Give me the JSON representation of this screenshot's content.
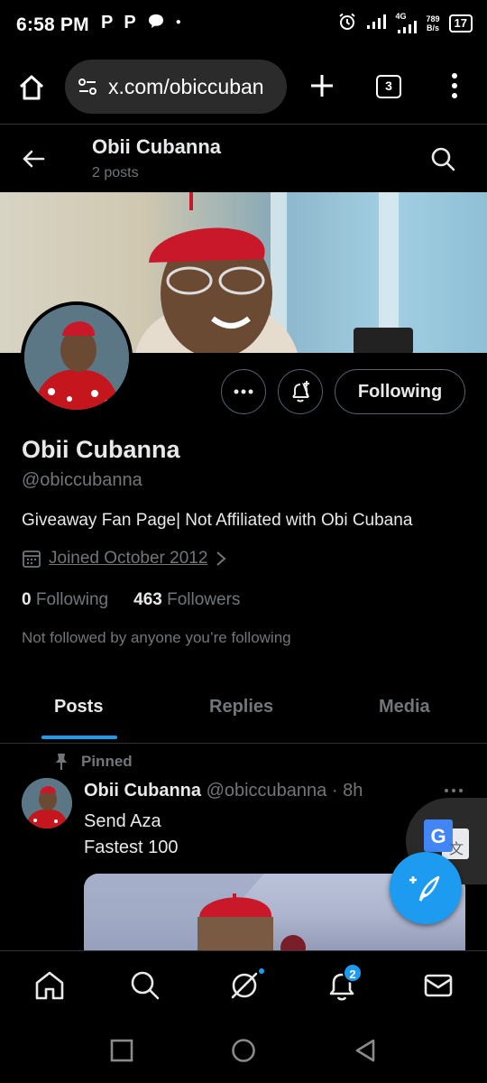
{
  "status_bar": {
    "time": "6:58 PM",
    "app_icons": [
      "P",
      "P"
    ],
    "network": "4G",
    "net_speed_value": "789",
    "net_speed_unit": "B/s",
    "battery": "17"
  },
  "browser": {
    "url": "x.com/obiccuban",
    "tab_count": "3"
  },
  "header": {
    "name": "Obii Cubanna",
    "post_count": "2 posts"
  },
  "profile": {
    "name": "Obii Cubanna",
    "handle": "@obiccubanna",
    "bio": "Giveaway Fan Page| Not Affiliated with Obi Cubana",
    "joined": "Joined October 2012",
    "following_count": "0",
    "following_label": "Following",
    "followers_count": "463",
    "followers_label": "Followers",
    "not_followed_text": "Not followed by anyone you’re following",
    "follow_button_label": "Following"
  },
  "tabs": [
    {
      "label": "Posts",
      "active": true
    },
    {
      "label": "Replies",
      "active": false
    },
    {
      "label": "Media",
      "active": false
    }
  ],
  "tweet": {
    "pinned_label": "Pinned",
    "author_name": "Obii Cubanna",
    "author_handle": "@obiccubanna",
    "time_separator": "·",
    "time": "8h",
    "text_line1": "Send Aza",
    "text_line2": "Fastest 100"
  },
  "bottom_nav": {
    "notifications_badge": "2"
  },
  "colors": {
    "accent": "#1d9bf0",
    "background": "#000000",
    "text_primary": "#e7e9ea",
    "text_secondary": "#71767b",
    "border": "#2f3336"
  },
  "icons": [
    "home-icon",
    "search-icon",
    "grok-icon",
    "notifications-icon",
    "messages-icon",
    "calendar-icon",
    "back-arrow-icon",
    "more-icon",
    "notify-plus-icon",
    "pin-icon",
    "compose-icon",
    "translate-icon"
  ]
}
